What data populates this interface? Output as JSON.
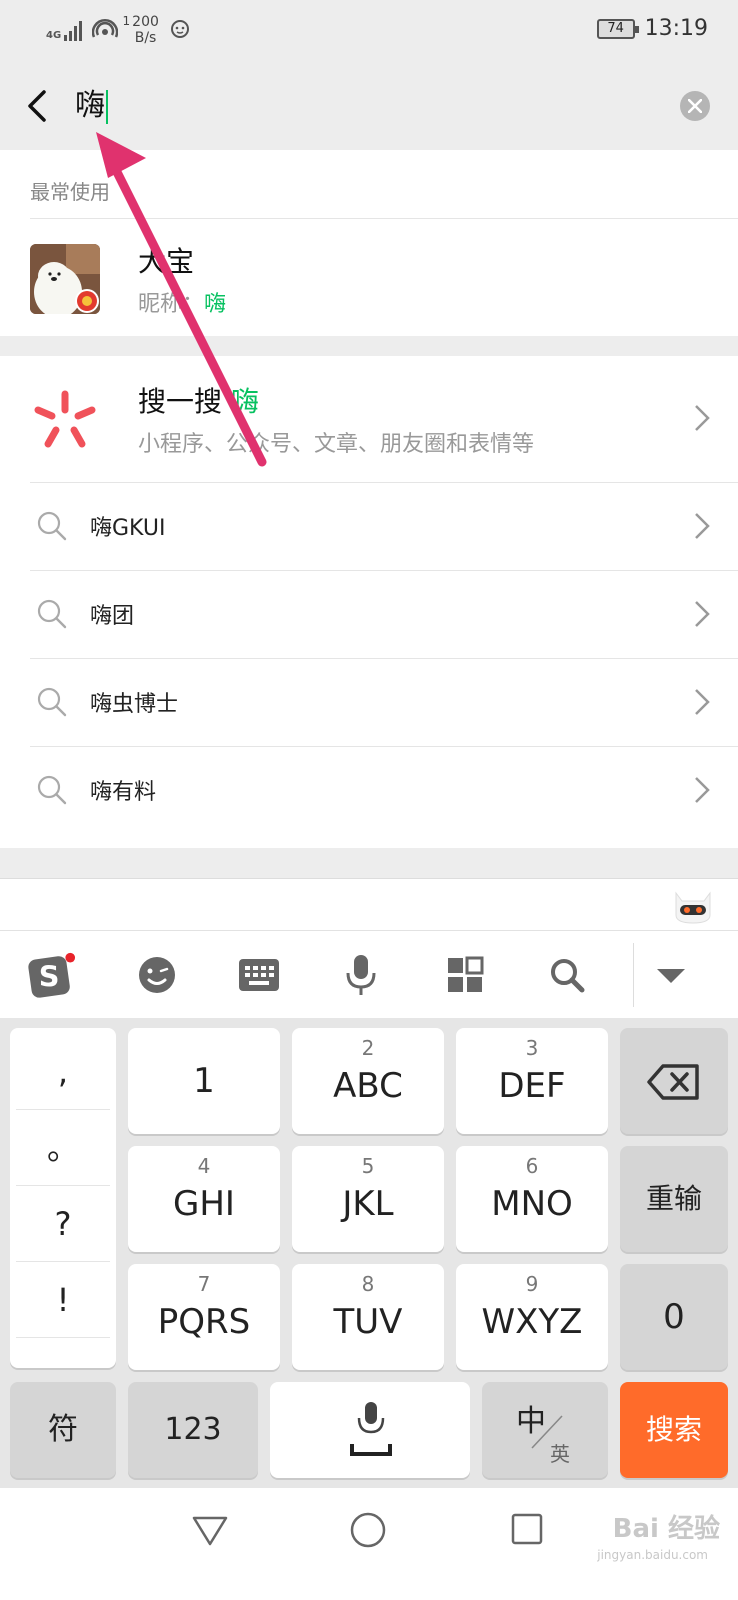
{
  "status_bar": {
    "network": "4G",
    "network_sub": "1",
    "speed_value": "200",
    "speed_unit": "B/s",
    "battery": "74",
    "time": "13:19"
  },
  "search": {
    "query": "嗨"
  },
  "frequent": {
    "section_label": "最常使用",
    "contact_name": "大宝",
    "contact_sub_prefix": "昵称：",
    "contact_sub_highlight": "嗨"
  },
  "sousou": {
    "title": "搜一搜",
    "title_highlight": "嗨",
    "subtitle": "小程序、公众号、文章、朋友圈和表情等"
  },
  "suggestions": [
    {
      "text": "嗨GKUI"
    },
    {
      "text": "嗨团"
    },
    {
      "text": "嗨虫博士"
    },
    {
      "text": "嗨有料"
    }
  ],
  "keyboard": {
    "punctuation": [
      ",",
      "。",
      "?",
      "!"
    ],
    "keys": [
      {
        "num": "",
        "label": "1"
      },
      {
        "num": "2",
        "label": "ABC"
      },
      {
        "num": "3",
        "label": "DEF"
      },
      {
        "num": "4",
        "label": "GHI"
      },
      {
        "num": "5",
        "label": "JKL"
      },
      {
        "num": "6",
        "label": "MNO"
      },
      {
        "num": "7",
        "label": "PQRS"
      },
      {
        "num": "8",
        "label": "TUV"
      },
      {
        "num": "9",
        "label": "WXYZ"
      }
    ],
    "reinput_label": "重输",
    "zero_label": "0",
    "symbol_label": "符",
    "numbers_label": "123",
    "lang_main": "中",
    "lang_sub": "英",
    "search_label": "搜索"
  },
  "watermark": {
    "text": "Bai 经验",
    "sub": "jingyan.baidu.com"
  },
  "colors": {
    "accent_green": "#07c160",
    "search_key": "#ff6b2a",
    "arrow": "#e0326e"
  }
}
